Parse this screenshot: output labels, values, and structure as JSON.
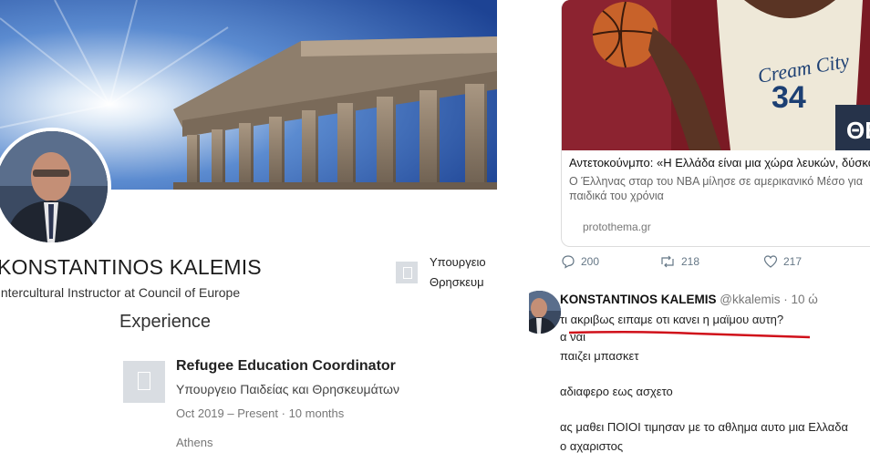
{
  "linkedin": {
    "name": "KONSTANTINOS KALEMIS",
    "headline": "Intercultural Instructor at Council of Europe",
    "org_line1": "Υπουργειο",
    "org_line2": "Θρησκευμ",
    "experience_heading": "Experience",
    "experience": {
      "role": "Refugee Education Coordinator",
      "employer": "Υπουργειο Παιδείας και Θρησκευμάτων",
      "dates": "Oct 2019 – Present · 10 months",
      "location": "Athens"
    }
  },
  "tweet_card": {
    "jersey_text": "34",
    "jersey_team": "Cream City",
    "corner_badge": "ΘΕ",
    "title": "Αντετοκούνμπο: «Η Ελλάδα είναι μια χώρα λευκών, δύσκο",
    "description_line1": "Ο Έλληνας σταρ του NBA μίλησε σε αμερικανικό Μέσο για",
    "description_line2": "παιδικά του χρόνια",
    "domain": "protothema.gr"
  },
  "tweet_actions": {
    "replies": "200",
    "retweets": "218",
    "likes": "217"
  },
  "reply": {
    "name": "KONSTANTINOS KALEMIS",
    "handle": "@kkalemis · 10 ώ",
    "lines": [
      "τι ακριβως ειπαμε οτι κανει η μαϊμου αυτη?",
      "α ναι",
      "παιζει μπασκετ",
      "αδιαφερο εως ασχετο",
      "ας μαθει ΠΟΙΟΙ τιμησαν με το αθλημα αυτο μια Ελλαδα",
      "ο αχαριστος"
    ]
  },
  "colors": {
    "underline": "#d0101a",
    "sky": "#2f5da8"
  }
}
